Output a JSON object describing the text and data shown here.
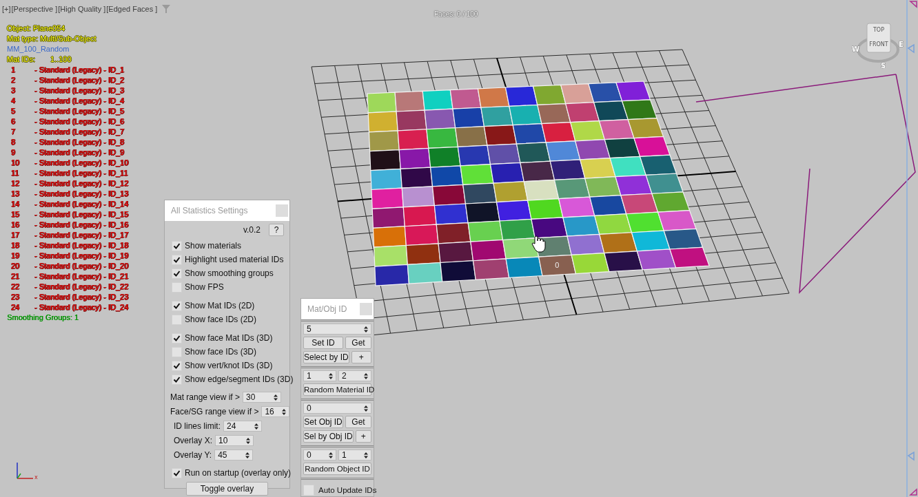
{
  "viewport": {
    "labels": [
      "[+]",
      "[Perspective ]",
      "[High Quality ]",
      "[Edged Faces ]"
    ],
    "faces_count": "Faces: 0 / 100",
    "face_label": "0",
    "axis_label": "x",
    "viewcube": {
      "top": "TOP",
      "front": "FRONT",
      "compass": [
        "W",
        "E",
        "S"
      ]
    }
  },
  "overlay": {
    "object": "Object: Plane054",
    "mat_type": "Mat type: Multi/Sub-Object",
    "material": "MM_100_Random",
    "mat_ids_label": "Mat IDs:",
    "mat_ids_range": "1..100",
    "ids": [
      {
        "id": "1",
        "text": "- Standard (Legacy) - ID_1"
      },
      {
        "id": "2",
        "text": "- Standard (Legacy) - ID_2"
      },
      {
        "id": "3",
        "text": "- Standard (Legacy) - ID_3"
      },
      {
        "id": "4",
        "text": "- Standard (Legacy) - ID_4"
      },
      {
        "id": "5",
        "text": "- Standard (Legacy) - ID_5"
      },
      {
        "id": "6",
        "text": "- Standard (Legacy) - ID_6"
      },
      {
        "id": "7",
        "text": "- Standard (Legacy) - ID_7"
      },
      {
        "id": "8",
        "text": "- Standard (Legacy) - ID_8"
      },
      {
        "id": "9",
        "text": "- Standard (Legacy) - ID_9"
      },
      {
        "id": "10",
        "text": "- Standard (Legacy) - ID_10"
      },
      {
        "id": "11",
        "text": "- Standard (Legacy) - ID_11"
      },
      {
        "id": "12",
        "text": "- Standard (Legacy) - ID_12"
      },
      {
        "id": "13",
        "text": "- Standard (Legacy) - ID_13"
      },
      {
        "id": "14",
        "text": "- Standard (Legacy) - ID_14"
      },
      {
        "id": "15",
        "text": "- Standard (Legacy) - ID_15"
      },
      {
        "id": "16",
        "text": "- Standard (Legacy) - ID_16"
      },
      {
        "id": "17",
        "text": "- Standard (Legacy) - ID_17"
      },
      {
        "id": "18",
        "text": "- Standard (Legacy) - ID_18"
      },
      {
        "id": "19",
        "text": "- Standard (Legacy) - ID_19"
      },
      {
        "id": "20",
        "text": "- Standard (Legacy) - ID_20"
      },
      {
        "id": "21",
        "text": "- Standard (Legacy) - ID_21"
      },
      {
        "id": "22",
        "text": "- Standard (Legacy) - ID_22"
      },
      {
        "id": "23",
        "text": "- Standard (Legacy) - ID_23"
      },
      {
        "id": "24",
        "text": "- Standard (Legacy) - ID_24"
      }
    ],
    "smoothing": "Smoothing Groups: 1"
  },
  "plane": {
    "rows": [
      {
        "faces": [
          {
            "color": "#9ed85a"
          },
          {
            "color": "#b87878"
          },
          {
            "color": "#10d0c0"
          },
          {
            "color": "#c05a90"
          },
          {
            "color": "#d07848"
          },
          {
            "color": "#2828d8"
          },
          {
            "color": "#80a830"
          },
          {
            "color": "#d8a098"
          },
          {
            "color": "#2850a8"
          },
          {
            "color": "#8020d8"
          }
        ]
      },
      {
        "faces": [
          {
            "color": "#d0b030"
          },
          {
            "color": "#983860"
          },
          {
            "color": "#8858b0"
          },
          {
            "color": "#1840a8"
          },
          {
            "color": "#30a0a0"
          },
          {
            "color": "#18b0b0"
          },
          {
            "color": "#986858"
          },
          {
            "color": "#c04070"
          },
          {
            "color": "#104858"
          },
          {
            "color": "#307818"
          }
        ]
      },
      {
        "faces": [
          {
            "color": "#a09848"
          },
          {
            "color": "#d82050"
          },
          {
            "color": "#38b840"
          },
          {
            "color": "#887048"
          },
          {
            "color": "#881818"
          },
          {
            "color": "#2048a8"
          },
          {
            "color": "#d82040"
          },
          {
            "color": "#b0d848"
          },
          {
            "color": "#d060a0"
          },
          {
            "color": "#a89830"
          }
        ]
      },
      {
        "faces": [
          {
            "color": "#201018"
          },
          {
            "color": "#8818a8"
          },
          {
            "color": "#108028"
          },
          {
            "color": "#2838b0"
          },
          {
            "color": "#6050a8"
          },
          {
            "color": "#205858"
          },
          {
            "color": "#5088d8"
          },
          {
            "color": "#9048b0"
          },
          {
            "color": "#104040"
          },
          {
            "color": "#d81098"
          }
        ]
      },
      {
        "faces": [
          {
            "color": "#40b0d8"
          },
          {
            "color": "#300848"
          },
          {
            "color": "#1048a8"
          },
          {
            "color": "#60e038"
          },
          {
            "color": "#2820b0"
          },
          {
            "color": "#482848"
          },
          {
            "color": "#302078"
          },
          {
            "color": "#d8d050"
          },
          {
            "color": "#40e0c0"
          },
          {
            "color": "#186070"
          }
        ]
      },
      {
        "faces": [
          {
            "color": "#e020a0"
          },
          {
            "color": "#b890d0"
          },
          {
            "color": "#880838"
          },
          {
            "color": "#304860"
          },
          {
            "color": "#b0a030"
          },
          {
            "color": "#d8e0c0"
          },
          {
            "color": "#589878"
          },
          {
            "color": "#80b858"
          },
          {
            "color": "#9030d8"
          },
          {
            "color": "#409090"
          }
        ]
      },
      {
        "faces": [
          {
            "color": "#901870"
          },
          {
            "color": "#d81850"
          },
          {
            "color": "#3030d0"
          },
          {
            "color": "#101428"
          },
          {
            "color": "#4020e0"
          },
          {
            "color": "#50d820"
          },
          {
            "color": "#d858d8"
          },
          {
            "color": "#1848a0"
          },
          {
            "color": "#c84878"
          },
          {
            "color": "#60a830"
          }
        ]
      },
      {
        "faces": [
          {
            "color": "#d87008"
          },
          {
            "color": "#d81858"
          },
          {
            "color": "#802028"
          },
          {
            "color": "#68d050"
          },
          {
            "color": "#30a048"
          },
          {
            "color": "#480880"
          },
          {
            "color": "#2898c8"
          },
          {
            "color": "#90d840"
          },
          {
            "color": "#50e030"
          },
          {
            "color": "#d858c8"
          }
        ]
      },
      {
        "faces": [
          {
            "color": "#a8e068"
          },
          {
            "color": "#903010"
          },
          {
            "color": "#581840"
          },
          {
            "color": "#a00870"
          },
          {
            "color": "#90d878"
          },
          {
            "color": "#608070"
          },
          {
            "color": "#9070d0"
          },
          {
            "color": "#b07018"
          },
          {
            "color": "#10b8d8"
          },
          {
            "color": "#285888"
          }
        ]
      },
      {
        "faces": [
          {
            "color": "#2828a8"
          },
          {
            "color": "#68d0c0"
          },
          {
            "color": "#100c38"
          },
          {
            "color": "#a04070"
          },
          {
            "color": "#0888b8"
          },
          {
            "color": "#886050"
          },
          {
            "color": "#98d838"
          },
          {
            "color": "#281048"
          },
          {
            "color": "#a050c8"
          },
          {
            "color": "#c01080"
          }
        ]
      }
    ]
  },
  "settings_panel": {
    "title": "All Statistics Settings",
    "version": "v.0.2",
    "help": "?",
    "checkbox_groups": [
      [
        {
          "label": "Show materials",
          "checked": true
        },
        {
          "label": "Highlight used material IDs",
          "checked": true
        },
        {
          "label": "Show smoothing groups",
          "checked": true
        },
        {
          "label": "Show FPS",
          "checked": false
        }
      ],
      [
        {
          "label": "Show Mat IDs (2D)",
          "checked": true
        },
        {
          "label": "Show face IDs (2D)",
          "checked": false
        }
      ],
      [
        {
          "label": "Show face Mat IDs (3D)",
          "checked": true
        },
        {
          "label": "Show face IDs (3D)",
          "checked": false
        },
        {
          "label": "Show vert/knot IDs (3D)",
          "checked": true
        },
        {
          "label": "Show edge/segment IDs (3D)",
          "checked": true
        }
      ]
    ],
    "spinners": [
      {
        "label": "Mat range view if >",
        "value": "30"
      },
      {
        "label": "Face/SG range view if >",
        "value": "16"
      },
      {
        "label": "ID lines limit:",
        "value": "24"
      },
      {
        "label": "Overlay X:",
        "value": "10"
      },
      {
        "label": "Overlay Y:",
        "value": "45"
      }
    ],
    "startup": {
      "label": "Run on startup (overlay only)",
      "checked": true
    },
    "toggle_button": "Toggle overlay"
  },
  "mat_obj_panel": {
    "title": "Mat/Obj ID",
    "sections": [
      {
        "kind": "id_tools",
        "value": "5",
        "set_label": "Set ID",
        "get_label": "Get",
        "select_label": "Select by ID",
        "add_label": "+"
      },
      {
        "kind": "random",
        "from": "1",
        "to": "2",
        "button": "Random Material ID"
      },
      {
        "kind": "id_tools",
        "value": "0",
        "set_label": "Set Obj ID",
        "get_label": "Get",
        "select_label": "Sel by Obj ID",
        "add_label": "+"
      },
      {
        "kind": "random",
        "from": "0",
        "to": "1",
        "button": "Random Object ID"
      },
      {
        "kind": "checkbox",
        "label": "Auto Update IDs",
        "checked": false
      }
    ]
  }
}
